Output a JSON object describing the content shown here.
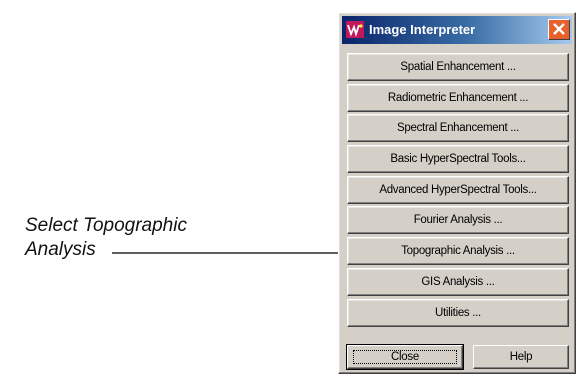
{
  "annotation": {
    "line1": "Select Topographic",
    "line2": "Analysis"
  },
  "window": {
    "title": "Image Interpreter",
    "app_icon": "erdas-icon",
    "close_icon": "close-icon",
    "title_gradient": [
      "#0a246a",
      "#a6caf0"
    ],
    "close_color": "#e8612c"
  },
  "menu": {
    "items": [
      {
        "label": "Spatial Enhancement ..."
      },
      {
        "label": "Radiometric Enhancement ..."
      },
      {
        "label": "Spectral Enhancement ..."
      },
      {
        "label": "Basic HyperSpectral Tools..."
      },
      {
        "label": "Advanced HyperSpectral Tools..."
      },
      {
        "label": "Fourier Analysis ..."
      },
      {
        "label": "Topographic Analysis ..."
      },
      {
        "label": "GIS Analysis ..."
      },
      {
        "label": "Utilities ..."
      }
    ]
  },
  "buttons": {
    "close_label": "Close",
    "help_label": "Help"
  }
}
